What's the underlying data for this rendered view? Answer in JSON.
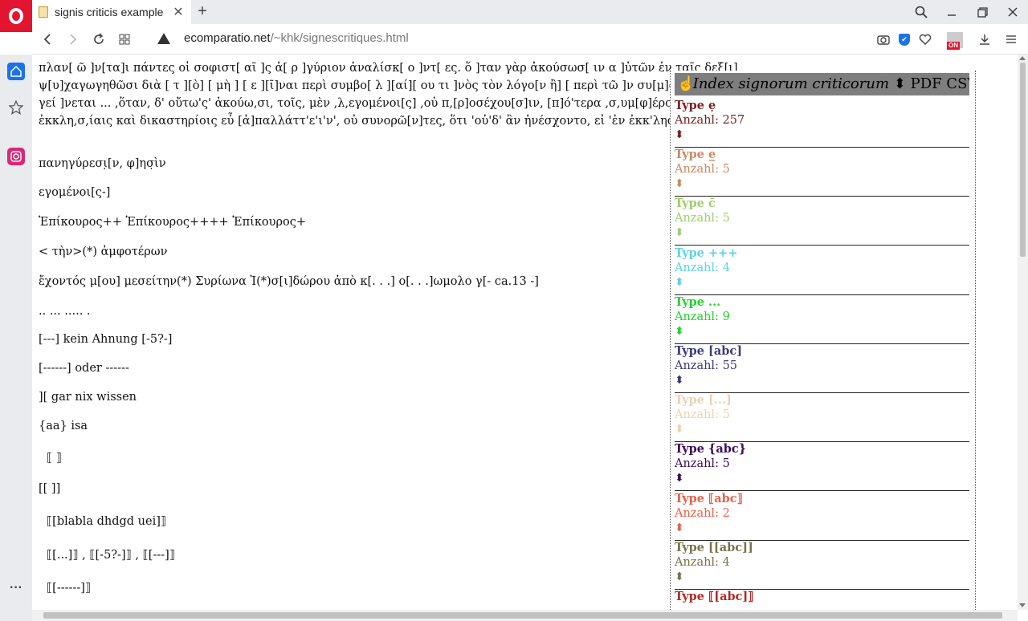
{
  "browser": {
    "tab_title": "signis criticis example",
    "tab_close": "✕",
    "new_tab": "+",
    "url_host": "ecomparatio.net",
    "url_path": "/~khk/signescritiques.html",
    "extension_badge": "ON"
  },
  "page": {
    "paragraph_lines": [
      "πλαν[ ῶ ]ν[τα]ι πάντες οἱ σοφιστ[ αῖ ]ς ἀ[ ρ ]γύριον ἀναλίσκ[ ο ]ντ[ ες. ὅ ]ταν γὰρ ἀκούσωσ[ ιν α ]ὐτῶν ἐν ταῖς δεξ[ι]",
      "ψ[υ]χαγωγηθῶσι διὰ [ τ ][ὸ] [ μὴ ] [ ε ][ῖ]ναι περὶ συμβο[ λ ][αί][ ου τι ]νὸς τὸν λόγο[ν ἢ] [ περὶ τῶ ]ν συ[μ]φερό[ν]",
      "γεί ]νεται ... ,ὅταν, δ' οὔτω'ς' ἀκούω,σι, τοῖς, μὲν ,λ,εγομένοι[ς] ,οὐ π,[ρ]οσέχου[σ]ιν, [π]ό'τερα ,σ,υμ[φ]έροντα ἢ οὐ",
      "ἐκκλη,σ,ίαις καὶ δικαστηρίοις εὖ [ἀ]παλλάττ'ε'ι'ν', οὐ συνορῶ[ν]τες, ὅτι 'οὐ'δ' ἂν ἠνέσχοντο, εἰ 'ἐν ἐκκ'λησίαι κ[αὶ]"
    ],
    "lines": [
      "πανηγύρεσι̣[ν, φ]ησ̣ὶν",
      "εγομένοι[ς-]",
      "Ἐπίκουρος++ Ἐπίκουρος++++ Ἐπίκουρος+",
      "< τὴν>(*) ἀμφοτέρων",
      "ἔχοντός μ[ου] μεσείτην(*) Συρίωνα Ἰ(*)σ[ι]δώρου ἀπὸ κ[. . .] ο[. . .]ωμολο γ[- ca.13 -]",
      ".. ... ..... .",
      "[---] kein Ahnung [-5?-]",
      "[------] oder ------",
      "][ gar nix wissen",
      "{aa} isa",
      "⟦ ⟧",
      "[[ ]]",
      "⟦[blabla dhdgd uei]⟧",
      "⟦[...]⟧   ,   ⟦[-5?-]⟧   ,   ⟦[---]⟧",
      "⟦[------]⟧"
    ]
  },
  "index_panel": {
    "title": "Index signorum criticorum",
    "hand_icon": "☝",
    "arrow": "⬍",
    "pdf": "PDF",
    "csv": "CSV",
    "entries": [
      {
        "type": "Type ẹ",
        "count": "Anzahl: 257",
        "arrow": "⬍",
        "color": "#7a1f1f"
      },
      {
        "type": "Type e̲",
        "count": "Anzahl: 5",
        "arrow": "⬍",
        "color": "#c98a66"
      },
      {
        "type": "Type c̄",
        "count": "Anzahl: 5",
        "arrow": "⬍",
        "color": "#9fcf6e"
      },
      {
        "type": "Type +++",
        "count": "Anzahl: 4",
        "arrow": "⬍",
        "color": "#5fd2e8"
      },
      {
        "type": "Type ...",
        "count": "Anzahl: 9",
        "arrow": "⬍",
        "color": "#22d32a"
      },
      {
        "type": "Type [abc]",
        "count": "Anzahl: 55",
        "arrow": "⬍",
        "color": "#3d3a7a"
      },
      {
        "type": "Type [...]",
        "count": "Anzahl: 5",
        "arrow": "⬍",
        "color": "#e9d4b2"
      },
      {
        "type": "Type {abc}",
        "count": "Anzahl: 5",
        "arrow": "⬍",
        "color": "#3c0c5e"
      },
      {
        "type": "Type   ⟦abc⟧",
        "count": "Anzahl: 2",
        "arrow": "⬍",
        "color": "#e8604a"
      },
      {
        "type": "Type [[abc]]",
        "count": "Anzahl: 4",
        "arrow": "⬍",
        "color": "#77734a"
      },
      {
        "type": "Type   ⟦[abc]⟧",
        "count": "",
        "arrow": "",
        "color": "#b02a24"
      }
    ]
  }
}
